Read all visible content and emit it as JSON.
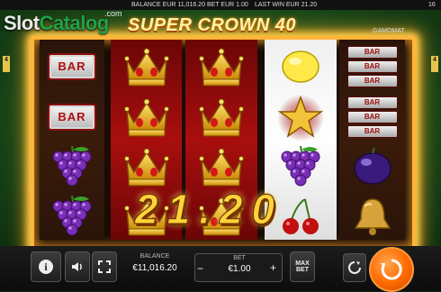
{
  "top_bar": {
    "balance": "BALANCE EUR 11,016.20",
    "bet": "BET EUR 1.00",
    "last_win": "LAST WIN EUR 21.20",
    "counter": "16"
  },
  "watermark": {
    "slot": "Slot",
    "catalog": "Catalog",
    "com": ".com"
  },
  "game": {
    "title": "SUPER CROWN 40",
    "provider": "GAMOMAT"
  },
  "lines": {
    "left": "4",
    "right": "4"
  },
  "reels": [
    {
      "bg": "dark",
      "symbols": [
        "bar",
        "bar",
        "grapes",
        "grapes"
      ]
    },
    {
      "bg": "red",
      "symbols": [
        "crown",
        "crown",
        "crown",
        "crown"
      ]
    },
    {
      "bg": "red",
      "symbols": [
        "crown",
        "crown",
        "crown",
        "crown"
      ]
    },
    {
      "bg": "white",
      "symbols": [
        "lemon",
        "star",
        "grapes",
        "cherries"
      ]
    },
    {
      "bg": "dark",
      "symbols": [
        "triple-bar",
        "triple-bar",
        "plum",
        "bell"
      ]
    }
  ],
  "symbol_text": {
    "bar": "BAR"
  },
  "big_win": "21.20",
  "bottom": {
    "balance_label": "BALANCE",
    "balance_value": "€11,016.20",
    "bet_label": "BET",
    "bet_value": "€1.00",
    "bet_minus": "−",
    "bet_plus": "+",
    "max_label": "MAX",
    "max_label2": "BET",
    "info_glyph": "i"
  },
  "colors": {
    "frame_glow": "#ffb43a",
    "spin": "#ff6a00",
    "win_text": "#ffd33a"
  },
  "icons": [
    "info-icon",
    "sound-icon",
    "fullscreen-icon",
    "autoplay-icon",
    "spin-icon"
  ]
}
